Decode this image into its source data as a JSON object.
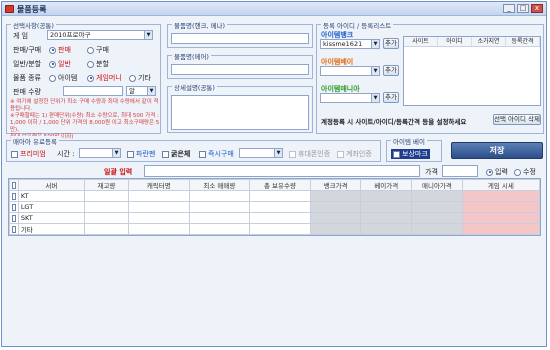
{
  "window": {
    "title": "물품등록",
    "min": "_",
    "max": "□",
    "close": "x"
  },
  "select_info": {
    "title": "선택사항(공통)",
    "game_label": "게   임",
    "game_value": "2010프로야구",
    "trade_label": "판매/구매",
    "trade_options": [
      "판매",
      "구매"
    ],
    "mode_label": "일반/분할",
    "mode_options": [
      "일반",
      "분할"
    ],
    "type_label": "물품 종류",
    "type_options": [
      "아이템",
      "게임머니",
      "기타"
    ],
    "qty_label": "판매 수량",
    "qty_value": "",
    "unit_value": "알",
    "notes": [
      "※ 여기에 설정한 단위가 최소 구매 수량과 최대 수량에서 같이 적용됩니다.",
      "※구매할때는 1) 판매단위(수량) 최소 수량으로, 최대 500 가격 :",
      "1,000 이하 / 1,000 단위 가격의 8,000원 이고 최소구매량은 5만),",
      "최대 보유량은 500만 이하)"
    ]
  },
  "title_panel": {
    "title": "물품명(핸크, 메나)",
    "value": ""
  },
  "price_panel": {
    "title": "물품명(메어)",
    "value": ""
  },
  "desc_panel": {
    "title": "상세설명(공통)",
    "value": ""
  },
  "accounts": {
    "title": "등록 아이디 / 등록리스트",
    "label_bank": "아이템뱅크",
    "bank_value": "kissme1621",
    "label_bay": "아이템베이",
    "label_mania": "아이템매니아",
    "add_label": "추가",
    "list_headers": [
      "사이트",
      "아이디",
      "소가지연",
      "등록간격"
    ],
    "hint": "계정등록 시 사이트/아이디/등록간격 등을 설정하세요",
    "delete_label": "선택 아이디 삭제"
  },
  "options": {
    "title": "매아아 유료등록",
    "premium": "프리미엄",
    "time_label": "시간 :",
    "time_value": "",
    "blue_label": "파란펜",
    "bold_label": "굵은체",
    "instant_label": "즉시구매",
    "phone_label": "휴대폰인증",
    "account_auth_label": "계좌인증"
  },
  "bay_box": {
    "title": "아이템 베이",
    "label": "보상마크"
  },
  "save_label": "저장",
  "batch": {
    "label": "일괄 입력",
    "price_label": "가격",
    "modes": [
      "입력",
      "수정"
    ]
  },
  "grid": {
    "headers": [
      "",
      "서버",
      "재고량",
      "캐릭터명",
      "최소 매매량",
      "총 보유수량",
      "뱅크가격",
      "베이가격",
      "매니아가격",
      "게임 시세"
    ],
    "rows": [
      {
        "name": "KT"
      },
      {
        "name": "LGT"
      },
      {
        "name": "SKT"
      },
      {
        "name": "기타"
      }
    ]
  }
}
